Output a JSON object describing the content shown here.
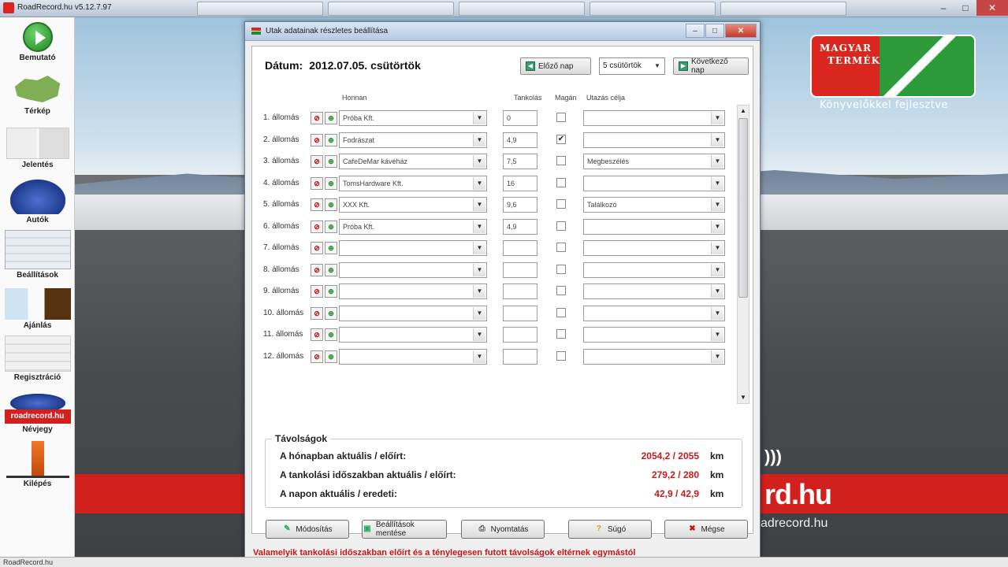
{
  "app": {
    "title": "RoadRecord.hu v5.12.7.97",
    "status": "RoadRecord.hu"
  },
  "sidebar": {
    "items": [
      {
        "label": "Bemutató",
        "icon": "play-icon"
      },
      {
        "label": "Térkép",
        "icon": "map-icon"
      },
      {
        "label": "Jelentés",
        "icon": "report-icon"
      },
      {
        "label": "Autók",
        "icon": "car-icon"
      },
      {
        "label": "Beállítások",
        "icon": "settings-icon"
      },
      {
        "label": "Ajánlás",
        "icon": "recommend-icon"
      },
      {
        "label": "Regisztráció",
        "icon": "registration-icon"
      },
      {
        "label": "Névjegy",
        "icon": "about-icon",
        "badge": "roadrecord.hu"
      },
      {
        "label": "Kilépés",
        "icon": "exit-icon"
      }
    ]
  },
  "background": {
    "logo_line1": "MAGYAR",
    "logo_line2": "TERMÉK",
    "logo_sub": "Könyvelőkkel fejlesztve",
    "band_text": "rd.hu",
    "band_sub": "adrecord.hu",
    "waves": ")))"
  },
  "dialog": {
    "title": "Utak adatainak részletes beállítása",
    "date_label": "Dátum:",
    "date_value": "2012.07.05. csütörtök",
    "prev_day": "Előző nap",
    "week_select": "5 csütörtök",
    "next_day": "Következő nap",
    "columns": {
      "partner": "Honnan",
      "fuel": "Tankolás",
      "private": "Magán",
      "purpose": "Utazás célja"
    },
    "rows": [
      {
        "label": "1. állomás",
        "partner": "Próba Kft.",
        "fuel": "0",
        "private": false,
        "purpose": ""
      },
      {
        "label": "2. állomás",
        "partner": "Fodrászat",
        "fuel": "4,9",
        "private": true,
        "purpose": ""
      },
      {
        "label": "3. állomás",
        "partner": "CafeDeMar kávéház",
        "fuel": "7,5",
        "private": false,
        "purpose": "Megbeszélés"
      },
      {
        "label": "4. állomás",
        "partner": "TomsHardware Kft.",
        "fuel": "16",
        "private": false,
        "purpose": ""
      },
      {
        "label": "5. állomás",
        "partner": "XXX Kft.",
        "fuel": "9,6",
        "private": false,
        "purpose": "Találkozó"
      },
      {
        "label": "6. állomás",
        "partner": "Próba Kft.",
        "fuel": "4,9",
        "private": false,
        "purpose": ""
      },
      {
        "label": "7. állomás",
        "partner": "",
        "fuel": "",
        "private": false,
        "purpose": ""
      },
      {
        "label": "8. állomás",
        "partner": "",
        "fuel": "",
        "private": false,
        "purpose": ""
      },
      {
        "label": "9. állomás",
        "partner": "",
        "fuel": "",
        "private": false,
        "purpose": ""
      },
      {
        "label": "10. állomás",
        "partner": "",
        "fuel": "",
        "private": false,
        "purpose": ""
      },
      {
        "label": "11. állomás",
        "partner": "",
        "fuel": "",
        "private": false,
        "purpose": ""
      },
      {
        "label": "12. állomás",
        "partner": "",
        "fuel": "",
        "private": false,
        "purpose": ""
      }
    ],
    "distances": {
      "legend": "Távolságok",
      "rows": [
        {
          "label": "A hónapban aktuális / előírt:",
          "value": "2054,2 / 2055",
          "unit": "km"
        },
        {
          "label": "A tankolási időszakban aktuális / előírt:",
          "value": "279,2 / 280",
          "unit": "km"
        },
        {
          "label": "A napon aktuális / eredeti:",
          "value": "42,9 / 42,9",
          "unit": "km"
        }
      ]
    },
    "buttons": {
      "modify": "Módosítás",
      "settings_save": "Beállítások mentése",
      "print": "Nyomtatás",
      "help": "Súgó",
      "cancel": "Mégse"
    },
    "warning": "Valamelyik tankolási időszakban előírt és a ténylegesen futott távolságok eltérnek egymástól"
  },
  "colors": {
    "accent_red": "#d2201e",
    "value_red": "#c81a1a",
    "warning_red": "#d01010"
  }
}
